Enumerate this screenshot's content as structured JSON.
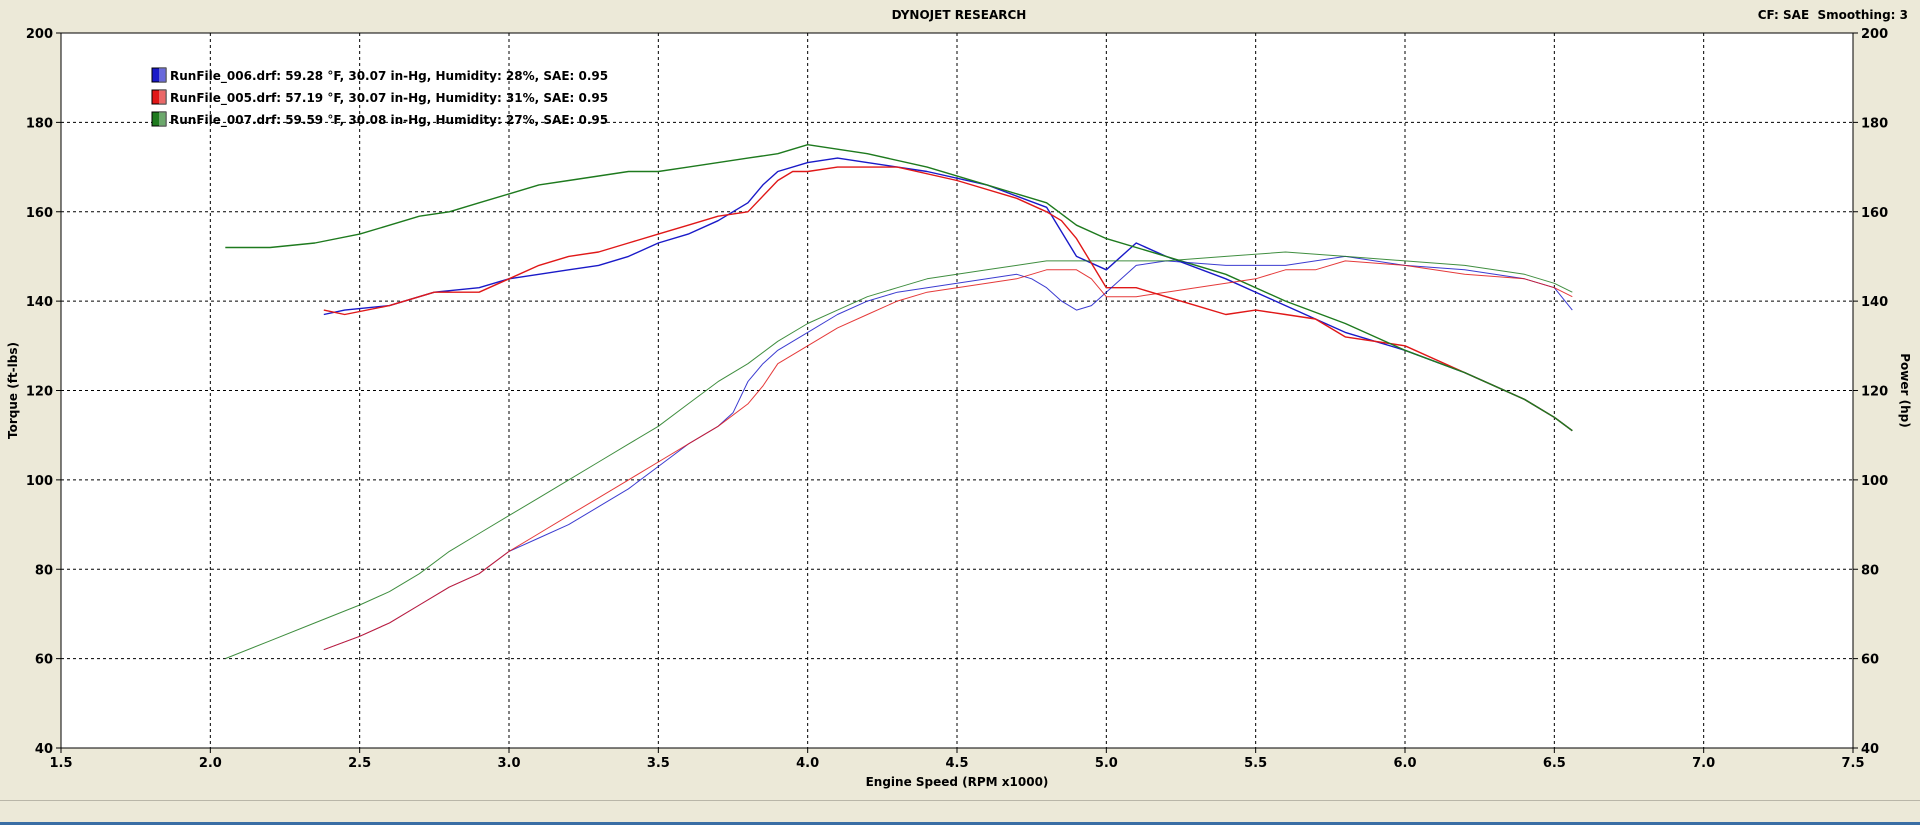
{
  "window": {
    "title": "DYNOJET RESEARCH",
    "header_right": "CF: SAE  Smoothing: 3"
  },
  "colors": {
    "background": "#ffffff",
    "frame": "#ece9d8",
    "grid": "#000000",
    "series_blue": "#1a1ac8",
    "series_red": "#e01818",
    "series_green": "#1e7a1e"
  },
  "chart_data": {
    "type": "line",
    "title": "DYNOJET RESEARCH",
    "xlabel": "Engine Speed (RPM x1000)",
    "ylabel_left": "Torque (ft-lbs)",
    "ylabel_right": "Power (hp)",
    "xlim": [
      1.5,
      7.5
    ],
    "ylim": [
      40,
      200
    ],
    "xticks": [
      "1.5",
      "2.0",
      "2.5",
      "3.0",
      "3.5",
      "4.0",
      "4.5",
      "5.0",
      "5.5",
      "6.0",
      "6.5",
      "7.0",
      "7.5"
    ],
    "yticks": [
      "200",
      "180",
      "160",
      "140",
      "120",
      "100",
      "80",
      "60",
      "40"
    ],
    "grid": true,
    "legend_position": "top-left",
    "legend": [
      {
        "label": "RunFile_006.drf: 59.28 °F, 30.07 in-Hg, Humidity: 28%, SAE: 0.95",
        "color": "#1a1ac8"
      },
      {
        "label": "RunFile_005.drf: 57.19 °F, 30.07 in-Hg, Humidity: 31%, SAE: 0.95",
        "color": "#e01818"
      },
      {
        "label": "RunFile_007.drf: 59.59 °F, 30.08 in-Hg, Humidity: 27%, SAE: 0.95",
        "color": "#1e7a1e"
      }
    ],
    "series": [
      {
        "name": "RunFile_006.drf",
        "measure": "torque",
        "color": "#1a1ac8",
        "width": 1.4,
        "x": [
          2.38,
          2.45,
          2.6,
          2.75,
          2.9,
          3.0,
          3.1,
          3.2,
          3.3,
          3.4,
          3.5,
          3.6,
          3.7,
          3.8,
          3.85,
          3.9,
          4.0,
          4.1,
          4.2,
          4.4,
          4.6,
          4.8,
          4.9,
          5.0,
          5.1,
          5.2,
          5.4,
          5.6,
          5.8,
          6.0,
          6.2,
          6.4,
          6.5,
          6.56
        ],
        "y": [
          137,
          138,
          139,
          142,
          143,
          145,
          146,
          147,
          148,
          150,
          153,
          155,
          158,
          162,
          166,
          169,
          171,
          172,
          171,
          169,
          166,
          161,
          150,
          147,
          153,
          150,
          145,
          139,
          133,
          129,
          124,
          118,
          114,
          111
        ]
      },
      {
        "name": "RunFile_005.drf",
        "measure": "torque",
        "color": "#e01818",
        "width": 1.4,
        "x": [
          2.38,
          2.45,
          2.6,
          2.75,
          2.9,
          3.0,
          3.1,
          3.2,
          3.3,
          3.4,
          3.5,
          3.6,
          3.7,
          3.8,
          3.9,
          3.95,
          4.0,
          4.1,
          4.3,
          4.5,
          4.7,
          4.8,
          4.85,
          4.9,
          5.0,
          5.1,
          5.2,
          5.3,
          5.4,
          5.5,
          5.6,
          5.7,
          5.8,
          6.0,
          6.2,
          6.4,
          6.5,
          6.56
        ],
        "y": [
          138,
          137,
          139,
          142,
          142,
          145,
          148,
          150,
          151,
          153,
          155,
          157,
          159,
          160,
          167,
          169,
          169,
          170,
          170,
          167,
          163,
          160,
          158,
          154,
          143,
          143,
          141,
          139,
          137,
          138,
          137,
          136,
          132,
          130,
          124,
          118,
          114,
          111
        ]
      },
      {
        "name": "RunFile_007.drf",
        "measure": "torque",
        "color": "#1e7a1e",
        "width": 1.4,
        "x": [
          2.05,
          2.2,
          2.35,
          2.5,
          2.6,
          2.7,
          2.8,
          2.9,
          3.0,
          3.1,
          3.2,
          3.3,
          3.4,
          3.5,
          3.6,
          3.7,
          3.8,
          3.9,
          4.0,
          4.1,
          4.2,
          4.4,
          4.6,
          4.8,
          4.9,
          5.0,
          5.2,
          5.4,
          5.6,
          5.8,
          6.0,
          6.2,
          6.4,
          6.5,
          6.56
        ],
        "y": [
          152,
          152,
          153,
          155,
          157,
          159,
          160,
          162,
          164,
          166,
          167,
          168,
          169,
          169,
          170,
          171,
          172,
          173,
          175,
          174,
          173,
          170,
          166,
          162,
          157,
          154,
          150,
          146,
          140,
          135,
          129,
          124,
          118,
          114,
          111
        ]
      },
      {
        "name": "RunFile_006.drf",
        "measure": "power",
        "color": "#1a1ac8",
        "width": 1.0,
        "x": [
          2.38,
          2.5,
          2.6,
          2.7,
          2.8,
          2.9,
          3.0,
          3.1,
          3.2,
          3.3,
          3.4,
          3.5,
          3.6,
          3.7,
          3.75,
          3.8,
          3.85,
          3.9,
          4.0,
          4.1,
          4.2,
          4.3,
          4.4,
          4.5,
          4.6,
          4.7,
          4.75,
          4.8,
          4.85,
          4.9,
          4.95,
          5.0,
          5.1,
          5.2,
          5.4,
          5.6,
          5.8,
          6.0,
          6.2,
          6.4,
          6.5,
          6.56
        ],
        "y": [
          62,
          65,
          68,
          72,
          76,
          79,
          84,
          87,
          90,
          94,
          98,
          103,
          108,
          112,
          115,
          122,
          126,
          129,
          133,
          137,
          140,
          142,
          143,
          144,
          145,
          146,
          145,
          143,
          140,
          138,
          139,
          142,
          148,
          149,
          148,
          148,
          150,
          148,
          147,
          145,
          143,
          138
        ]
      },
      {
        "name": "RunFile_005.drf",
        "measure": "power",
        "color": "#e01818",
        "width": 1.0,
        "x": [
          2.38,
          2.5,
          2.6,
          2.7,
          2.8,
          2.9,
          3.0,
          3.1,
          3.2,
          3.3,
          3.4,
          3.5,
          3.6,
          3.7,
          3.8,
          3.85,
          3.9,
          4.0,
          4.1,
          4.2,
          4.3,
          4.4,
          4.5,
          4.6,
          4.7,
          4.8,
          4.85,
          4.9,
          4.95,
          5.0,
          5.1,
          5.2,
          5.3,
          5.4,
          5.5,
          5.6,
          5.7,
          5.8,
          6.0,
          6.2,
          6.4,
          6.5,
          6.56
        ],
        "y": [
          62,
          65,
          68,
          72,
          76,
          79,
          84,
          88,
          92,
          96,
          100,
          104,
          108,
          112,
          117,
          121,
          126,
          130,
          134,
          137,
          140,
          142,
          143,
          144,
          145,
          147,
          147,
          147,
          145,
          141,
          141,
          142,
          143,
          144,
          145,
          147,
          147,
          149,
          148,
          146,
          145,
          143,
          141
        ]
      },
      {
        "name": "RunFile_007.drf",
        "measure": "power",
        "color": "#1e7a1e",
        "width": 1.0,
        "x": [
          2.05,
          2.2,
          2.35,
          2.5,
          2.6,
          2.7,
          2.8,
          2.9,
          3.0,
          3.1,
          3.2,
          3.3,
          3.4,
          3.5,
          3.6,
          3.7,
          3.8,
          3.9,
          4.0,
          4.1,
          4.2,
          4.3,
          4.4,
          4.5,
          4.6,
          4.7,
          4.8,
          4.9,
          5.0,
          5.1,
          5.2,
          5.4,
          5.6,
          5.8,
          6.0,
          6.2,
          6.4,
          6.5,
          6.56
        ],
        "y": [
          60,
          64,
          68,
          72,
          75,
          79,
          84,
          88,
          92,
          96,
          100,
          104,
          108,
          112,
          117,
          122,
          126,
          131,
          135,
          138,
          141,
          143,
          145,
          146,
          147,
          148,
          149,
          149,
          149,
          149,
          149,
          150,
          151,
          150,
          149,
          148,
          146,
          144,
          142
        ]
      }
    ]
  }
}
